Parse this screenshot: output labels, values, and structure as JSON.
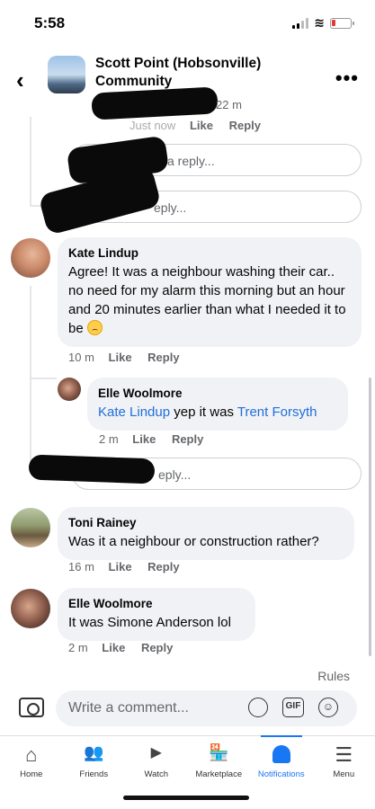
{
  "status": {
    "time": "5:58"
  },
  "header": {
    "group_name": "Scott Point (Hobsonville) Community",
    "more": "•••",
    "back": "‹"
  },
  "top_comment": {
    "time": "22 m",
    "meta_partial": "Just now",
    "like": "Like",
    "reply": "Reply"
  },
  "partial_reply_1": "a reply...",
  "partial_reply_2": "eply...",
  "comments": [
    {
      "author": "Kate Lindup",
      "text": "Agree! It was a neighbour washing their car.. no need for my alarm this morning but an hour and 20 minutes earlier than what I needed it to be",
      "time": "10 m",
      "like": "Like",
      "reply": "Reply",
      "replies": [
        {
          "author": "Elle Woolmore",
          "mention1": "Kate Lindup",
          "text": " yep it was ",
          "mention2": "Trent Forsyth",
          "time": "2 m",
          "like": "Like",
          "reply": "Reply"
        }
      ],
      "reply_box": "eply..."
    },
    {
      "author": "Toni Rainey",
      "text": "Was it a neighbour or construction rather?",
      "time": "16 m",
      "like": "Like",
      "reply": "Reply"
    },
    {
      "author": "Elle Woolmore",
      "text": "It was Simone Anderson lol",
      "time": "2 m",
      "like": "Like",
      "reply": "Reply"
    }
  ],
  "rules": "Rules",
  "composer": {
    "placeholder": "Write a comment...",
    "gif": "GIF"
  },
  "tabs": [
    {
      "label": "Home",
      "icon": "home-icon",
      "glyph": "⌂"
    },
    {
      "label": "Friends",
      "icon": "friends-icon",
      "glyph": "👥"
    },
    {
      "label": "Watch",
      "icon": "watch-icon",
      "glyph": "▶"
    },
    {
      "label": "Marketplace",
      "icon": "marketplace-icon",
      "glyph": "🏪"
    },
    {
      "label": "Notifications",
      "icon": "bell-icon",
      "glyph": ""
    },
    {
      "label": "Menu",
      "icon": "menu-icon",
      "glyph": "☰"
    }
  ],
  "colors": {
    "accent": "#1877f2",
    "mention": "#216fdb",
    "bubble": "#f0f2f5"
  }
}
